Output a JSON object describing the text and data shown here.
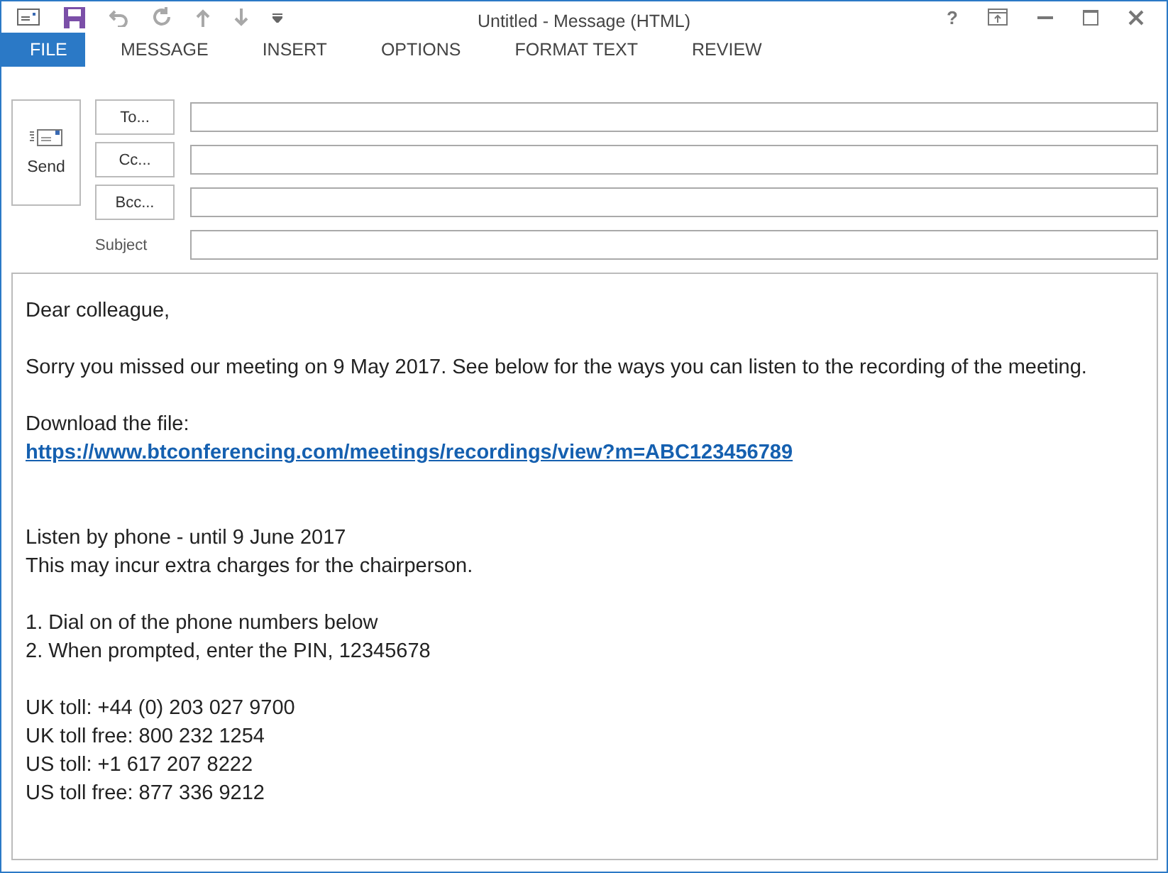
{
  "window": {
    "title": "Untitled - Message (HTML)",
    "help": "?"
  },
  "tabs": [
    {
      "label": "FILE",
      "selected": true
    },
    {
      "label": "MESSAGE",
      "selected": false
    },
    {
      "label": "INSERT",
      "selected": false
    },
    {
      "label": "OPTIONS",
      "selected": false
    },
    {
      "label": "FORMAT TEXT",
      "selected": false
    },
    {
      "label": "REVIEW",
      "selected": false
    }
  ],
  "send_button": {
    "label": "Send"
  },
  "fields": [
    {
      "kind": "button",
      "label": "To..."
    },
    {
      "kind": "button",
      "label": "Cc..."
    },
    {
      "kind": "button",
      "label": "Bcc..."
    },
    {
      "kind": "label",
      "label": "Subject"
    }
  ],
  "body": [
    [
      {
        "kind": "text",
        "text": "Dear colleague,"
      }
    ],
    [
      {
        "kind": "text",
        "text": "Sorry you missed our meeting on 9 May 2017. See below for the ways you can listen to the recording of the meeting."
      }
    ],
    [
      {
        "kind": "text",
        "text": "Download the file:"
      },
      {
        "kind": "link",
        "text": "https://www.btconferencing.com/meetings/recordings/view?m=ABC123456789"
      }
    ],
    [
      {
        "kind": "text",
        "text": "Listen by phone - until 9 June 2017"
      },
      {
        "kind": "text",
        "text": "This may incur extra charges for the chairperson."
      }
    ],
    [
      {
        "kind": "text",
        "text": "1. Dial on of the phone numbers below"
      },
      {
        "kind": "text",
        "text": "2. When prompted, enter the PIN, 12345678"
      }
    ],
    [
      {
        "kind": "text",
        "text": "UK toll: +44 (0) 203 027 9700"
      },
      {
        "kind": "text",
        "text": "UK toll free: 800 232 1254"
      },
      {
        "kind": "text",
        "text": "US toll: +1 617 207 8222"
      },
      {
        "kind": "text",
        "text": "US toll free: 877 336 9212"
      }
    ]
  ]
}
